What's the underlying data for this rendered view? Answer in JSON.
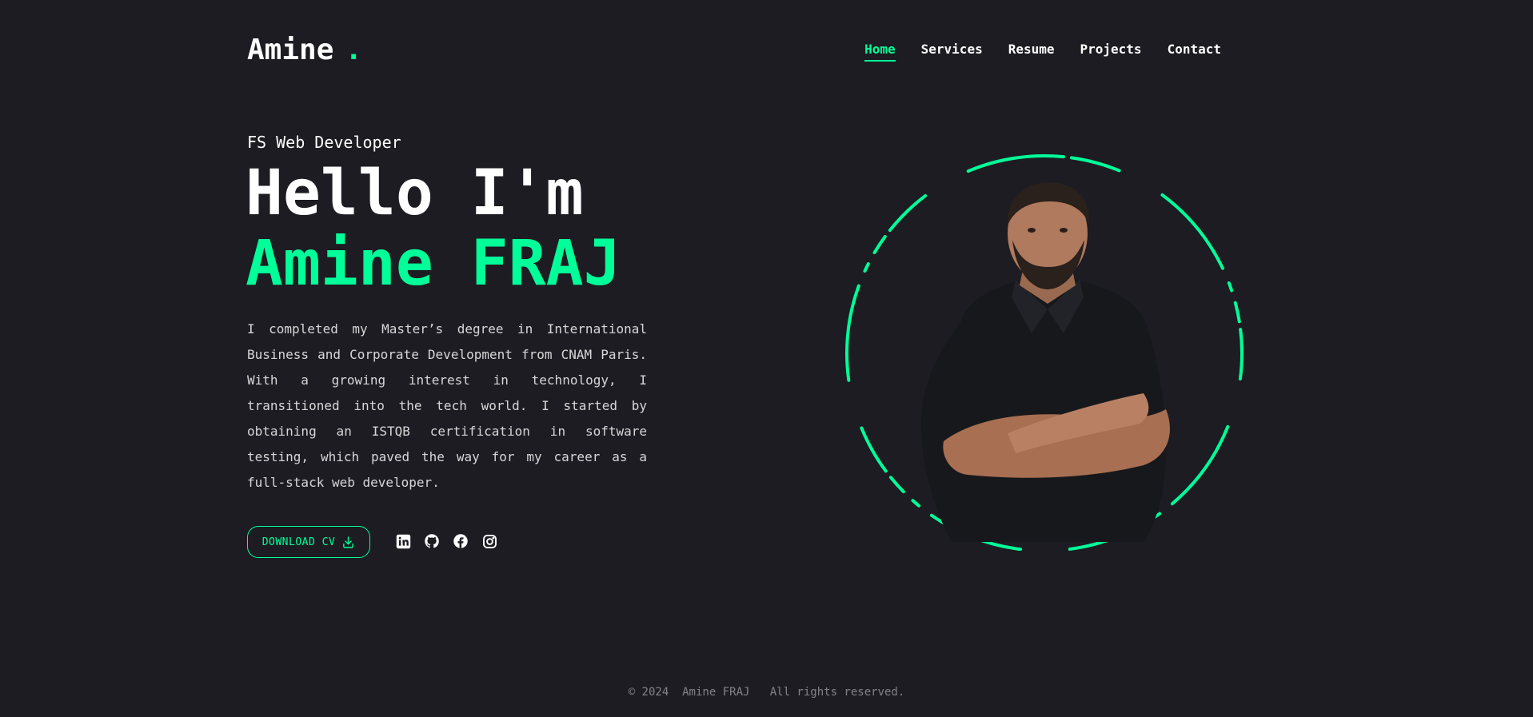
{
  "header": {
    "logo_text": "Amine",
    "logo_dot": ".",
    "nav": [
      {
        "label": "Home",
        "active": true
      },
      {
        "label": "Services",
        "active": false
      },
      {
        "label": "Resume",
        "active": false
      },
      {
        "label": "Projects",
        "active": false
      },
      {
        "label": "Contact",
        "active": false
      }
    ]
  },
  "hero": {
    "role": "FS Web Developer",
    "greeting": "Hello I'm",
    "name": "Amine FRAJ",
    "bio": "I completed my Master’s degree in International Business and Corporate Development from CNAM Paris. With a growing interest in technology, I transitioned into the tech world. I started by obtaining an ISTQB certification in software testing, which paved the way for my career as a full-stack web developer.",
    "download_label": "DOWNLOAD CV",
    "download_icon": "download-icon",
    "socials": [
      {
        "name": "linkedin-icon"
      },
      {
        "name": "github-icon"
      },
      {
        "name": "facebook-icon"
      },
      {
        "name": "instagram-icon"
      }
    ]
  },
  "footer": {
    "text": "© 2024  Amine FRAJ   All rights reserved."
  },
  "colors": {
    "background": "#1c1c22",
    "accent": "#00ff99",
    "text": "#ffffff"
  }
}
